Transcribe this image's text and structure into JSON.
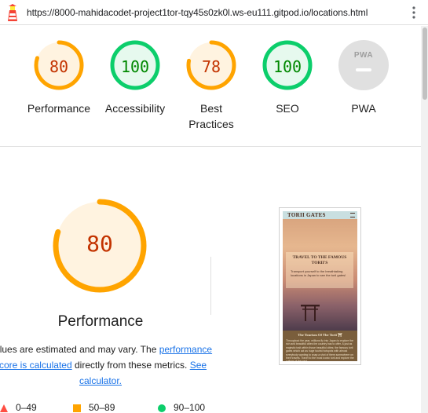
{
  "browser": {
    "url": "https://8000-mahidacodet-project1tor-tqy45s0zk0l.ws-eu111.gitpod.io/locations.html",
    "logo_icon": "lighthouse-icon",
    "menu_icon": "kebab-menu-icon"
  },
  "colors": {
    "fail": "#ff4e42",
    "average": "#ffa400",
    "pass": "#0cce6b",
    "average_text": "#c33300",
    "pass_text": "#008800",
    "pwa_gray": "#e0e0e0"
  },
  "scores": [
    {
      "label": "Performance",
      "value": 80,
      "rating": "average"
    },
    {
      "label": "Accessibility",
      "value": 100,
      "rating": "pass"
    },
    {
      "label": "Best Practices",
      "label_lines": [
        "Best",
        "Practices"
      ],
      "value": 78,
      "rating": "average"
    },
    {
      "label": "SEO",
      "value": 100,
      "rating": "pass"
    }
  ],
  "pwa": {
    "badge": "PWA",
    "label": "PWA"
  },
  "performance": {
    "score": 80,
    "title": "Performance",
    "note_before": "Values are estimated and may vary. The ",
    "note_link1": "performance score is calculated",
    "note_middle": " directly from these metrics. ",
    "note_link2": "See calculator."
  },
  "legend": [
    {
      "range": "0–49",
      "shape": "triangle"
    },
    {
      "range": "50–89",
      "shape": "square"
    },
    {
      "range": "90–100",
      "shape": "circle"
    }
  ],
  "thumbnail": {
    "brand": "TORII GATES",
    "hero_heading": "TRAVEL TO THE FAMOUS TORII'S",
    "hero_text": "Transport yourself to the breathtaking locations in Japan to see the torii gates!",
    "section_heading": "The Tourism Of The Torii ⛩",
    "section_text": "Throughout the year, millions fly into Japan to explore the rich and beautiful cities the country has to offer. A just as majestic trait within those beautiful cities; the famous torii gates which act as huge tourist hotspots with almost everybody wanting to snap a shot of them somewhere on their travels. Travel to the most iconic torii and explore the culture of the past."
  }
}
